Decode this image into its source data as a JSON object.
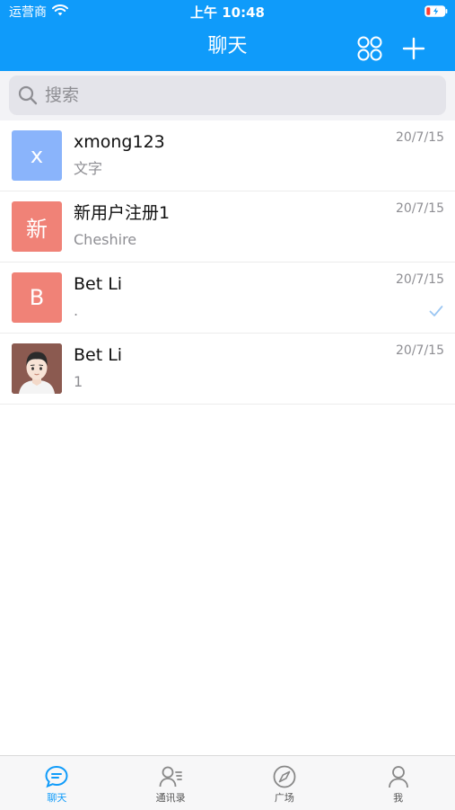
{
  "status_bar": {
    "carrier": "运营商",
    "time": "上午 10:48"
  },
  "header": {
    "title": "聊天"
  },
  "search": {
    "placeholder": "搜索"
  },
  "conversations": [
    {
      "avatar_text": "x",
      "avatar_color": "#8ab4fb",
      "name": "xmong123",
      "preview": "文字",
      "time": "20/7/15"
    },
    {
      "avatar_text": "新",
      "avatar_color": "#f08277",
      "name": "新用户注册1",
      "preview": "Cheshire",
      "time": "20/7/15"
    },
    {
      "avatar_text": "B",
      "avatar_color": "#f08277",
      "name": "Bet Li",
      "preview": ".",
      "time": "20/7/15"
    },
    {
      "avatar_text": "",
      "avatar_color": "#8b5a50",
      "name": "Bet Li",
      "preview": "1",
      "time": "20/7/15"
    }
  ],
  "tabs": [
    {
      "label": "聊天",
      "icon": "chat-icon",
      "active": true
    },
    {
      "label": "通讯录",
      "icon": "contacts-icon",
      "active": false
    },
    {
      "label": "广场",
      "icon": "compass-icon",
      "active": false
    },
    {
      "label": "我",
      "icon": "profile-icon",
      "active": false
    }
  ],
  "colors": {
    "brand": "#0f9bfa",
    "avatar_blue": "#8ab4fb",
    "avatar_red": "#f08277"
  }
}
